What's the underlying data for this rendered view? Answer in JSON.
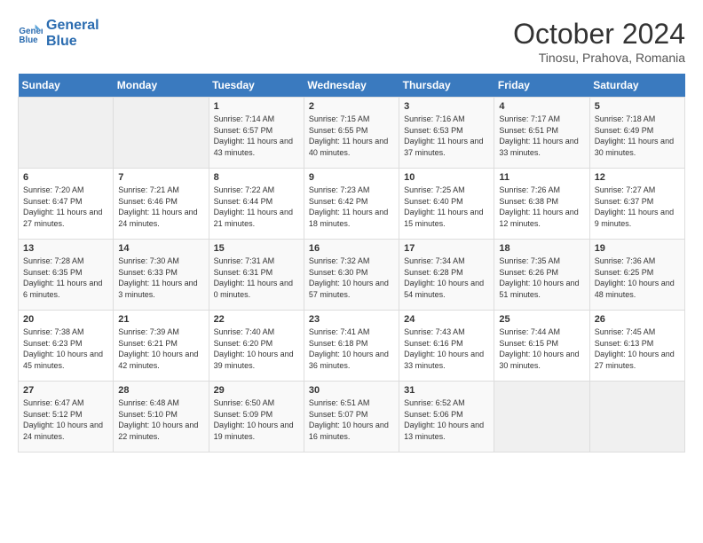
{
  "header": {
    "logo_line1": "General",
    "logo_line2": "Blue",
    "month": "October 2024",
    "location": "Tinosu, Prahova, Romania"
  },
  "weekdays": [
    "Sunday",
    "Monday",
    "Tuesday",
    "Wednesday",
    "Thursday",
    "Friday",
    "Saturday"
  ],
  "weeks": [
    [
      {
        "day": "",
        "sunrise": "",
        "sunset": "",
        "daylight": ""
      },
      {
        "day": "",
        "sunrise": "",
        "sunset": "",
        "daylight": ""
      },
      {
        "day": "1",
        "sunrise": "Sunrise: 7:14 AM",
        "sunset": "Sunset: 6:57 PM",
        "daylight": "Daylight: 11 hours and 43 minutes."
      },
      {
        "day": "2",
        "sunrise": "Sunrise: 7:15 AM",
        "sunset": "Sunset: 6:55 PM",
        "daylight": "Daylight: 11 hours and 40 minutes."
      },
      {
        "day": "3",
        "sunrise": "Sunrise: 7:16 AM",
        "sunset": "Sunset: 6:53 PM",
        "daylight": "Daylight: 11 hours and 37 minutes."
      },
      {
        "day": "4",
        "sunrise": "Sunrise: 7:17 AM",
        "sunset": "Sunset: 6:51 PM",
        "daylight": "Daylight: 11 hours and 33 minutes."
      },
      {
        "day": "5",
        "sunrise": "Sunrise: 7:18 AM",
        "sunset": "Sunset: 6:49 PM",
        "daylight": "Daylight: 11 hours and 30 minutes."
      }
    ],
    [
      {
        "day": "6",
        "sunrise": "Sunrise: 7:20 AM",
        "sunset": "Sunset: 6:47 PM",
        "daylight": "Daylight: 11 hours and 27 minutes."
      },
      {
        "day": "7",
        "sunrise": "Sunrise: 7:21 AM",
        "sunset": "Sunset: 6:46 PM",
        "daylight": "Daylight: 11 hours and 24 minutes."
      },
      {
        "day": "8",
        "sunrise": "Sunrise: 7:22 AM",
        "sunset": "Sunset: 6:44 PM",
        "daylight": "Daylight: 11 hours and 21 minutes."
      },
      {
        "day": "9",
        "sunrise": "Sunrise: 7:23 AM",
        "sunset": "Sunset: 6:42 PM",
        "daylight": "Daylight: 11 hours and 18 minutes."
      },
      {
        "day": "10",
        "sunrise": "Sunrise: 7:25 AM",
        "sunset": "Sunset: 6:40 PM",
        "daylight": "Daylight: 11 hours and 15 minutes."
      },
      {
        "day": "11",
        "sunrise": "Sunrise: 7:26 AM",
        "sunset": "Sunset: 6:38 PM",
        "daylight": "Daylight: 11 hours and 12 minutes."
      },
      {
        "day": "12",
        "sunrise": "Sunrise: 7:27 AM",
        "sunset": "Sunset: 6:37 PM",
        "daylight": "Daylight: 11 hours and 9 minutes."
      }
    ],
    [
      {
        "day": "13",
        "sunrise": "Sunrise: 7:28 AM",
        "sunset": "Sunset: 6:35 PM",
        "daylight": "Daylight: 11 hours and 6 minutes."
      },
      {
        "day": "14",
        "sunrise": "Sunrise: 7:30 AM",
        "sunset": "Sunset: 6:33 PM",
        "daylight": "Daylight: 11 hours and 3 minutes."
      },
      {
        "day": "15",
        "sunrise": "Sunrise: 7:31 AM",
        "sunset": "Sunset: 6:31 PM",
        "daylight": "Daylight: 11 hours and 0 minutes."
      },
      {
        "day": "16",
        "sunrise": "Sunrise: 7:32 AM",
        "sunset": "Sunset: 6:30 PM",
        "daylight": "Daylight: 10 hours and 57 minutes."
      },
      {
        "day": "17",
        "sunrise": "Sunrise: 7:34 AM",
        "sunset": "Sunset: 6:28 PM",
        "daylight": "Daylight: 10 hours and 54 minutes."
      },
      {
        "day": "18",
        "sunrise": "Sunrise: 7:35 AM",
        "sunset": "Sunset: 6:26 PM",
        "daylight": "Daylight: 10 hours and 51 minutes."
      },
      {
        "day": "19",
        "sunrise": "Sunrise: 7:36 AM",
        "sunset": "Sunset: 6:25 PM",
        "daylight": "Daylight: 10 hours and 48 minutes."
      }
    ],
    [
      {
        "day": "20",
        "sunrise": "Sunrise: 7:38 AM",
        "sunset": "Sunset: 6:23 PM",
        "daylight": "Daylight: 10 hours and 45 minutes."
      },
      {
        "day": "21",
        "sunrise": "Sunrise: 7:39 AM",
        "sunset": "Sunset: 6:21 PM",
        "daylight": "Daylight: 10 hours and 42 minutes."
      },
      {
        "day": "22",
        "sunrise": "Sunrise: 7:40 AM",
        "sunset": "Sunset: 6:20 PM",
        "daylight": "Daylight: 10 hours and 39 minutes."
      },
      {
        "day": "23",
        "sunrise": "Sunrise: 7:41 AM",
        "sunset": "Sunset: 6:18 PM",
        "daylight": "Daylight: 10 hours and 36 minutes."
      },
      {
        "day": "24",
        "sunrise": "Sunrise: 7:43 AM",
        "sunset": "Sunset: 6:16 PM",
        "daylight": "Daylight: 10 hours and 33 minutes."
      },
      {
        "day": "25",
        "sunrise": "Sunrise: 7:44 AM",
        "sunset": "Sunset: 6:15 PM",
        "daylight": "Daylight: 10 hours and 30 minutes."
      },
      {
        "day": "26",
        "sunrise": "Sunrise: 7:45 AM",
        "sunset": "Sunset: 6:13 PM",
        "daylight": "Daylight: 10 hours and 27 minutes."
      }
    ],
    [
      {
        "day": "27",
        "sunrise": "Sunrise: 6:47 AM",
        "sunset": "Sunset: 5:12 PM",
        "daylight": "Daylight: 10 hours and 24 minutes."
      },
      {
        "day": "28",
        "sunrise": "Sunrise: 6:48 AM",
        "sunset": "Sunset: 5:10 PM",
        "daylight": "Daylight: 10 hours and 22 minutes."
      },
      {
        "day": "29",
        "sunrise": "Sunrise: 6:50 AM",
        "sunset": "Sunset: 5:09 PM",
        "daylight": "Daylight: 10 hours and 19 minutes."
      },
      {
        "day": "30",
        "sunrise": "Sunrise: 6:51 AM",
        "sunset": "Sunset: 5:07 PM",
        "daylight": "Daylight: 10 hours and 16 minutes."
      },
      {
        "day": "31",
        "sunrise": "Sunrise: 6:52 AM",
        "sunset": "Sunset: 5:06 PM",
        "daylight": "Daylight: 10 hours and 13 minutes."
      },
      {
        "day": "",
        "sunrise": "",
        "sunset": "",
        "daylight": ""
      },
      {
        "day": "",
        "sunrise": "",
        "sunset": "",
        "daylight": ""
      }
    ]
  ]
}
